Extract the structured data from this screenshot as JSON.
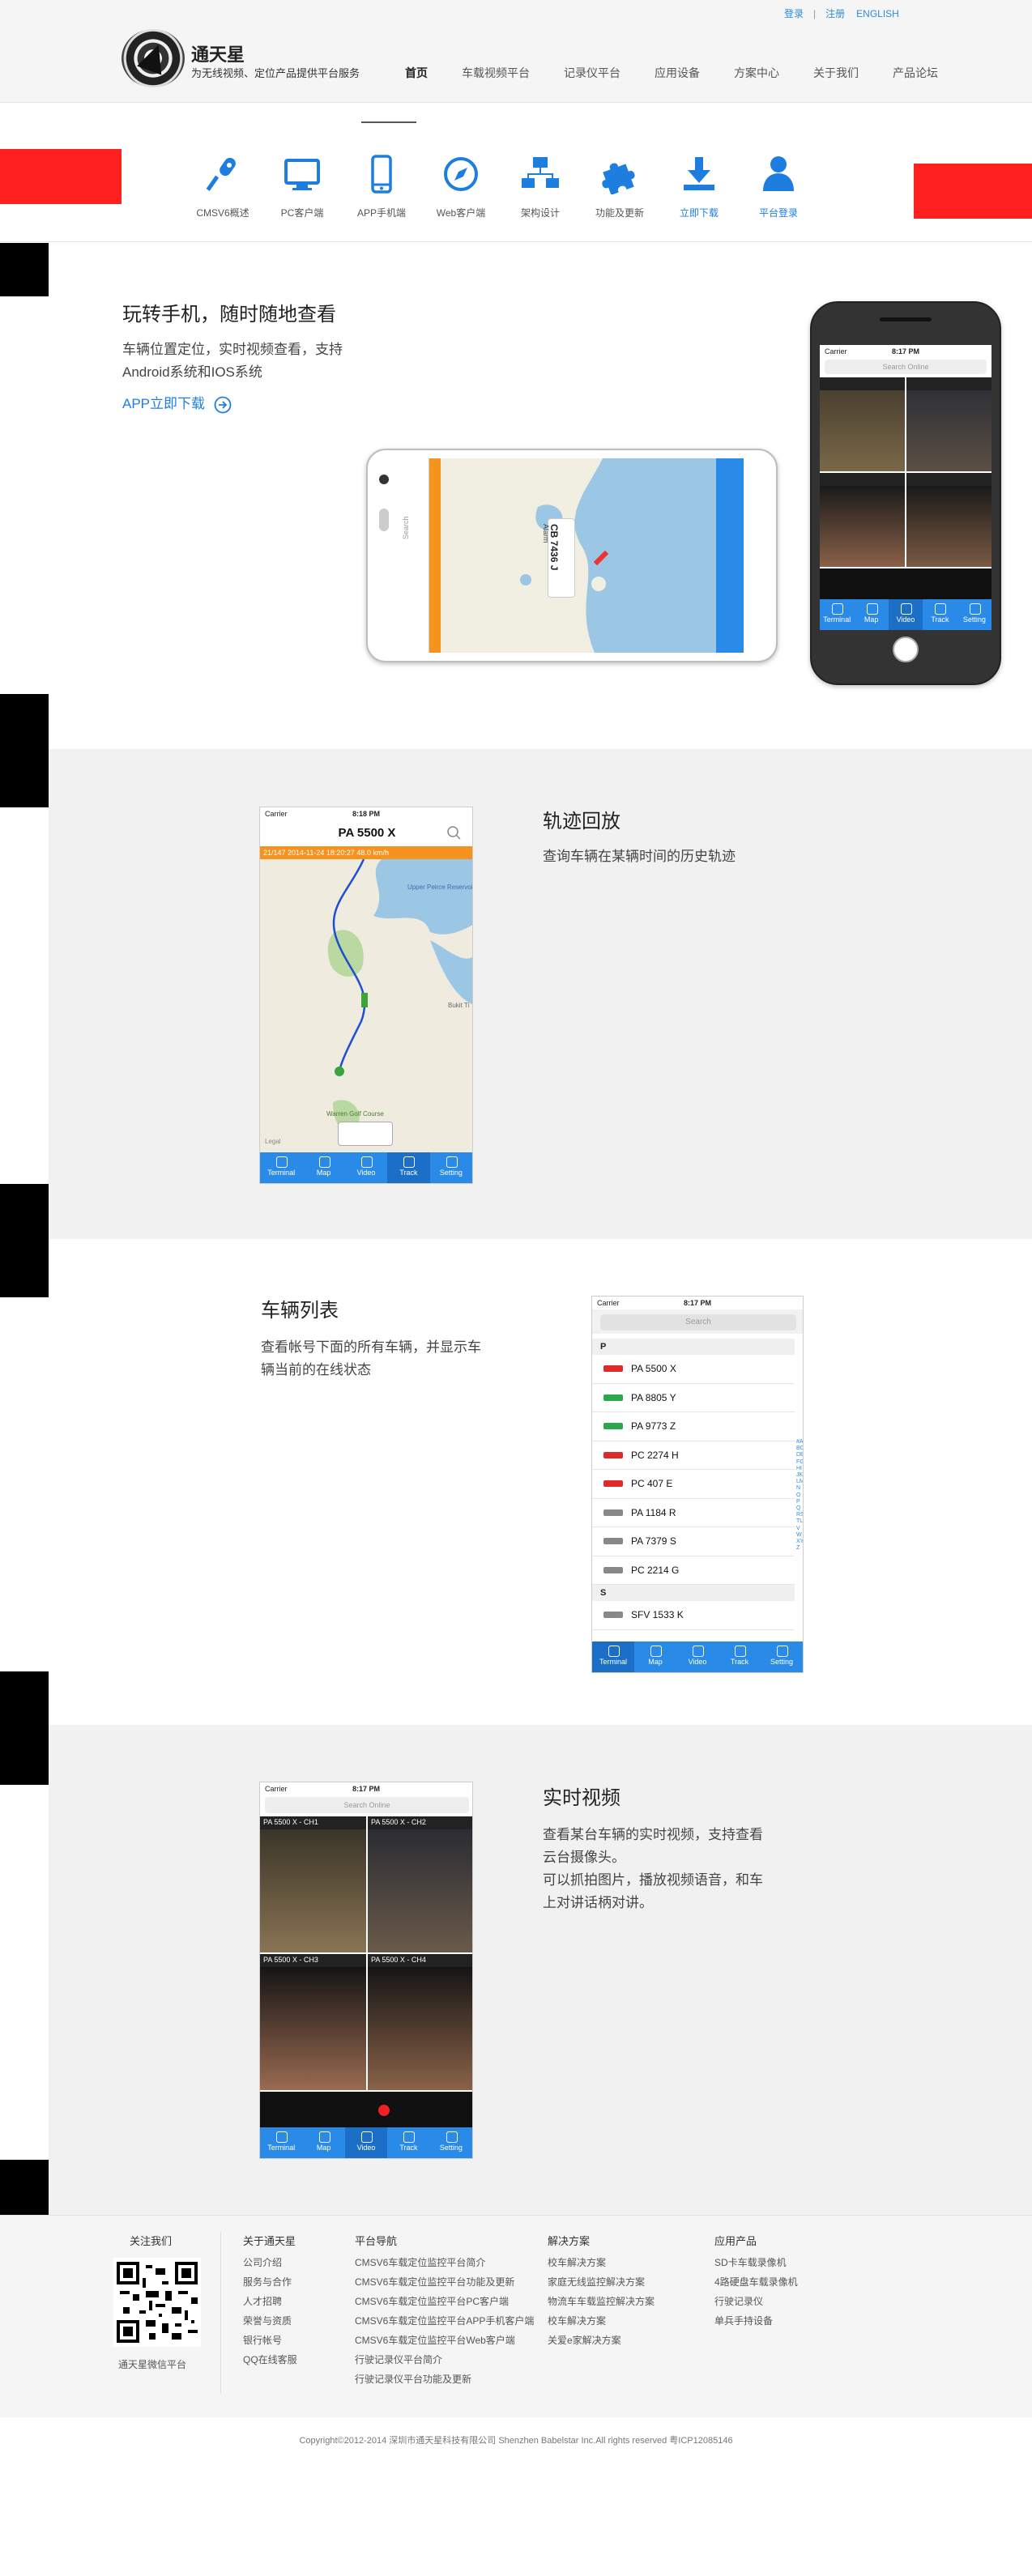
{
  "header": {
    "links": {
      "login": "登录",
      "register": "注册",
      "english": "ENGLISH"
    },
    "logo_title": "通天星",
    "logo_sub": "为无线视频、定位产品提供平台服务",
    "nav": [
      "首页",
      "车载视频平台",
      "记录仪平台",
      "应用设备",
      "方案中心",
      "关于我们",
      "产品论坛"
    ]
  },
  "subnav": {
    "items": [
      {
        "label": "CMSV6概述",
        "icon": "microphone-icon"
      },
      {
        "label": "PC客户端",
        "icon": "monitor-icon"
      },
      {
        "label": "APP手机端",
        "icon": "mobile-phone-icon"
      },
      {
        "label": "Web客户端",
        "icon": "compass-icon"
      },
      {
        "label": "架构设计",
        "icon": "network-icon"
      },
      {
        "label": "功能及更新",
        "icon": "puzzle-icon"
      },
      {
        "label": "立即下载",
        "icon": "download-icon"
      },
      {
        "label": "平台登录",
        "icon": "user-icon"
      }
    ]
  },
  "section1": {
    "title": "玩转手机，随时随地查看",
    "text1": "车辆位置定位，实时视频查看，支持",
    "text2": "Android系统和IOS系统",
    "download": "APP立即下载",
    "android_phone": {
      "plate": "CB 7436 J",
      "callout": "Alarm",
      "search": "Search"
    },
    "iphone": {
      "carrier": "Carrier",
      "time": "8:17 PM",
      "search": "Search Online"
    }
  },
  "section2": {
    "title": "轨迹回放",
    "text": "查询车辆在某辆时间的历史轨迹",
    "phone": {
      "carrier": "Carrier",
      "time": "8:18 PM",
      "plate": "PA 5500 X",
      "track_info": "21/147   2014-11-24 18:20:27  48.0 km/h",
      "map_labels": [
        "Upper Peirce Reservoir",
        "Bukit Ti",
        "Warren Golf Course",
        "Legal"
      ]
    }
  },
  "section3": {
    "title": "车辆列表",
    "text1": "查看帐号下面的所有车辆，并显示车",
    "text2": "辆当前的在线状态",
    "phone": {
      "carrier": "Carrier",
      "time": "8:17 PM",
      "search": "Search",
      "groups": [
        {
          "letter": "P",
          "vehicles": [
            {
              "plate": "PA 5500 X",
              "status": "red"
            },
            {
              "plate": "PA 8805 Y",
              "status": "green"
            },
            {
              "plate": "PA 9773 Z",
              "status": "green"
            },
            {
              "plate": "PC 2274 H",
              "status": "red"
            },
            {
              "plate": "PC 407 E",
              "status": "red"
            },
            {
              "plate": "PA 1184 R",
              "status": "gray"
            },
            {
              "plate": "PA 7379 S",
              "status": "gray"
            },
            {
              "plate": "PC 2214 G",
              "status": "gray"
            }
          ]
        },
        {
          "letter": "S",
          "vehicles": [
            {
              "plate": "SFV 1533 K",
              "status": "gray"
            }
          ]
        }
      ],
      "index": "#ABCDEFGHIJKLMNOPQRSTUVWXYZ"
    }
  },
  "section4": {
    "title": "实时视频",
    "lines": [
      "查看某台车辆的实时视频，支持查看",
      "云台摄像头。",
      "可以抓拍图片，播放视频语音，和车",
      "上对讲话柄对讲。"
    ],
    "phone": {
      "carrier": "Carrier",
      "time": "8:17 PM",
      "search": "Search Online",
      "channels": [
        "PA 5500 X - CH1",
        "PA 5500 X - CH2",
        "PA 5500 X - CH3",
        "PA 5500 X - CH4"
      ]
    }
  },
  "tabs": [
    "Terminal",
    "Map",
    "Video",
    "Track",
    "Setting"
  ],
  "footer": {
    "follow": {
      "title": "关注我们",
      "caption": "通天星微信平台"
    },
    "about": {
      "title": "关于通天星",
      "items": [
        "公司介绍",
        "服务与合作",
        "人才招聘",
        "荣誉与资质",
        "银行帐号",
        "QQ在线客服"
      ]
    },
    "platform": {
      "title": "平台导航",
      "items": [
        "CMSV6车载定位监控平台简介",
        "CMSV6车载定位监控平台功能及更新",
        "CMSV6车载定位监控平台PC客户端",
        "CMSV6车载定位监控平台APP手机客户端",
        "CMSV6车载定位监控平台Web客户端",
        "行驶记录仪平台简介",
        "行驶记录仪平台功能及更新"
      ]
    },
    "solutions": {
      "title": "解决方案",
      "items": [
        "校车解决方案",
        "家庭无线监控解决方案",
        "物流车车载监控解决方案",
        "校车解决方案",
        "关爱e家解决方案"
      ]
    },
    "products": {
      "title": "应用产品",
      "items": [
        "SD卡车载录像机",
        "4路硬盘车载录像机",
        "行驶记录仪",
        "单兵手持设备"
      ]
    }
  },
  "copyright": "Copyright©2012-2014 深圳市通天星科技有限公司  Shenzhen Babelstar Inc.All rights reserved 粤ICP12085146"
}
